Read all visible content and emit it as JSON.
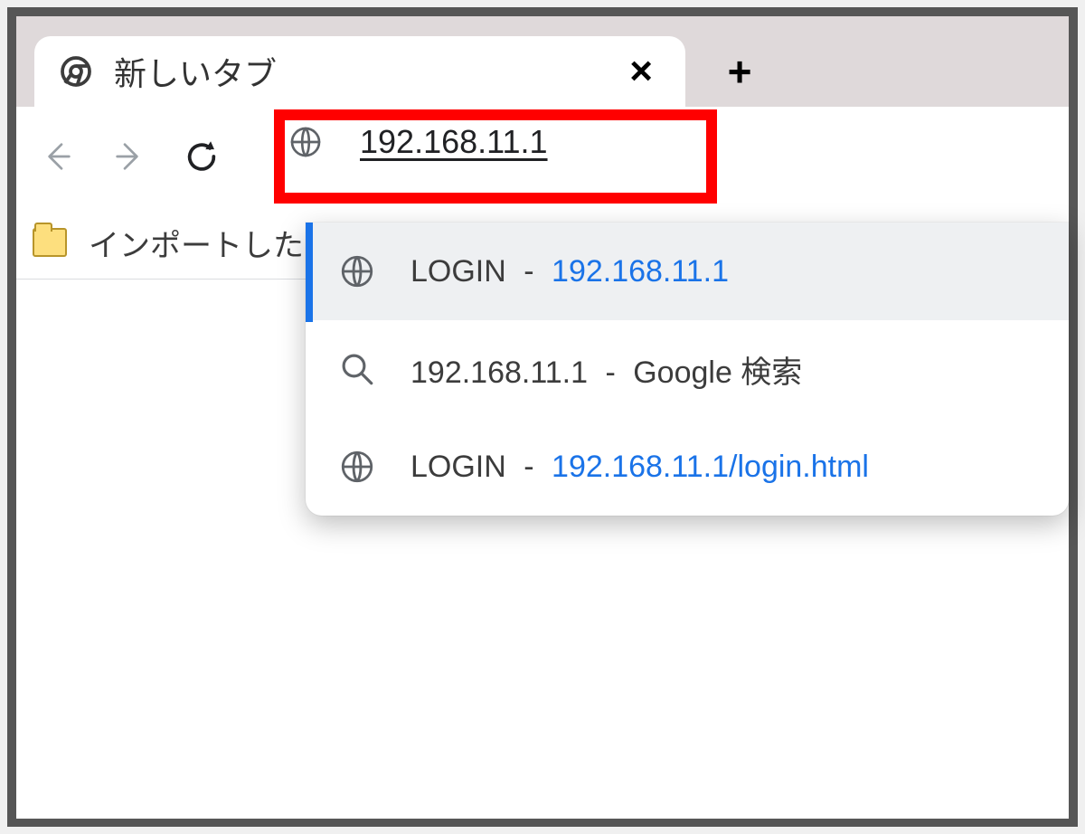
{
  "tab": {
    "title": "新しいタブ"
  },
  "bookmarks": {
    "imported_label": "インポートした"
  },
  "address": {
    "value": "192.168.11.1"
  },
  "suggestions": [
    {
      "icon": "globe",
      "title": "LOGIN",
      "url": "192.168.11.1",
      "link_style": true,
      "selected": true
    },
    {
      "icon": "search",
      "title": "192.168.11.1",
      "url": "Google 検索",
      "link_style": false,
      "selected": false
    },
    {
      "icon": "globe",
      "title": "LOGIN",
      "url": "192.168.11.1/login.html",
      "link_style": true,
      "selected": false
    }
  ]
}
